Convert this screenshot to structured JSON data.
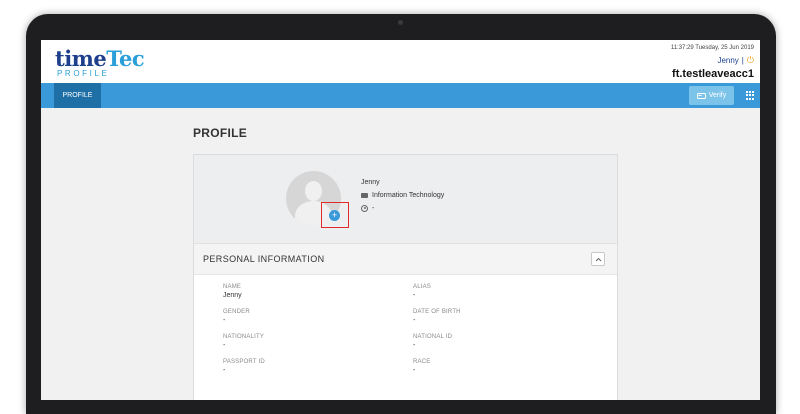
{
  "header": {
    "logo_main_a": "time",
    "logo_main_b": "Tec",
    "logo_sub": "PROFILE",
    "datetime": "11:37:29 Tuesday, 25 Jun 2019",
    "user": "Jenny",
    "separator": "|",
    "company": "ft.testleaveacc1"
  },
  "nav": {
    "active_tab": "PROFILE",
    "verify_label": "Verify"
  },
  "page": {
    "title": "PROFILE"
  },
  "profile": {
    "name": "Jenny",
    "department": "Information Technology",
    "manager": "-"
  },
  "personal_info": {
    "section_title": "PERSONAL INFORMATION",
    "fields": [
      {
        "label": "NAME",
        "value": "Jenny"
      },
      {
        "label": "ALIAS",
        "value": "-"
      },
      {
        "label": "GENDER",
        "value": "-"
      },
      {
        "label": "DATE OF BIRTH",
        "value": "-"
      },
      {
        "label": "NATIONALITY",
        "value": "-"
      },
      {
        "label": "NATIONAL ID",
        "value": "-"
      },
      {
        "label": "PASSPORT ID",
        "value": "-"
      },
      {
        "label": "RACE",
        "value": "-"
      }
    ]
  },
  "colors": {
    "nav_bar": "#3a9ad9",
    "active_tab": "#1d6fa6",
    "highlight_box": "#e02b2b",
    "logo_dark": "#1d3f8c",
    "logo_light": "#2a9fd8"
  },
  "icons": {
    "upload_photo": "camera-plus-icon",
    "department": "briefcase-icon",
    "manager": "user-circle-icon",
    "apps": "grid-icon",
    "logout": "power-icon",
    "collapse": "chevron-up-icon"
  }
}
